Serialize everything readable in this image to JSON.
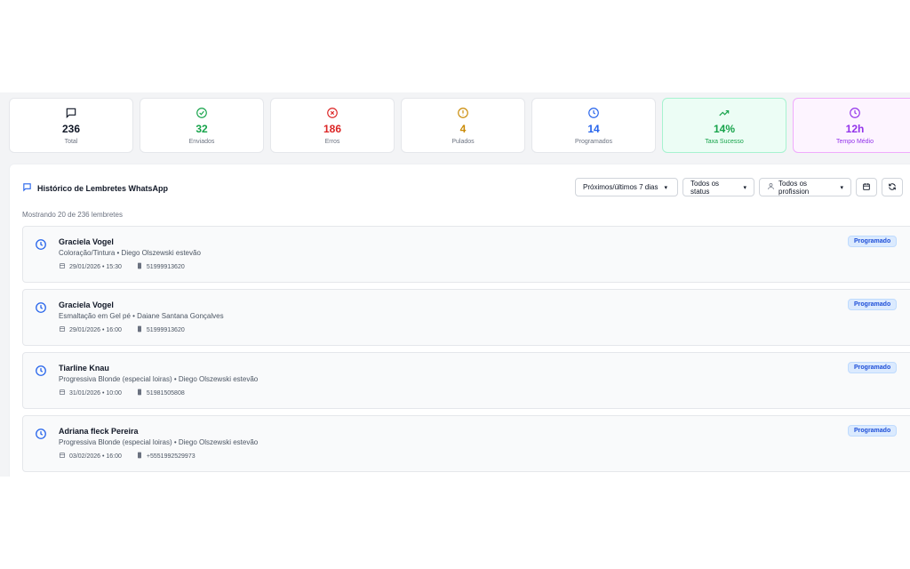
{
  "colors": {
    "blue": "#2563eb",
    "green": "#16a34a",
    "red": "#dc2626",
    "amber": "#ca8a04",
    "purple": "#9333ea",
    "dark": "#111827"
  },
  "stats": [
    {
      "value": "236",
      "label": "Total",
      "icon": "message-icon"
    },
    {
      "value": "32",
      "label": "Enviados",
      "icon": "check-circle-icon"
    },
    {
      "value": "186",
      "label": "Erros",
      "icon": "x-circle-icon"
    },
    {
      "value": "4",
      "label": "Pulados",
      "icon": "alert-circle-icon"
    },
    {
      "value": "14",
      "label": "Programados",
      "icon": "clock-icon"
    },
    {
      "value": "14%",
      "label": "Taxa Sucesso",
      "icon": "trending-up-icon"
    },
    {
      "value": "12h",
      "label": "Tempo Médio",
      "icon": "clock-icon"
    }
  ],
  "history": {
    "title": "Histórico de Lembretes WhatsApp",
    "showing": "Mostrando 20 de 236 lembretes",
    "filters": {
      "period": "Próximos/últimos 7 dias",
      "status": "Todos os status",
      "professional": "Todos os profission"
    }
  },
  "reminders": [
    {
      "name": "Graciela Vogel",
      "service": "Coloração/Tintura • Diego Olszewski estevão",
      "datetime": "29/01/2026 • 15:30",
      "phone": "51999913620",
      "status": "Programado"
    },
    {
      "name": "Graciela Vogel",
      "service": "Esmaltação em Gel pé • Daiane Santana Gonçalves",
      "datetime": "29/01/2026 • 16:00",
      "phone": "51999913620",
      "status": "Programado"
    },
    {
      "name": "Tiarline Knau",
      "service": "Progressiva Blonde (especial loiras) • Diego Olszewski estevão",
      "datetime": "31/01/2026 • 10:00",
      "phone": "51981505808",
      "status": "Programado"
    },
    {
      "name": "Adriana fleck Pereira",
      "service": "Progressiva Blonde (especial loiras) • Diego Olszewski estevão",
      "datetime": "03/02/2026 • 16:00",
      "phone": "+5551992529973",
      "status": "Programado"
    }
  ]
}
